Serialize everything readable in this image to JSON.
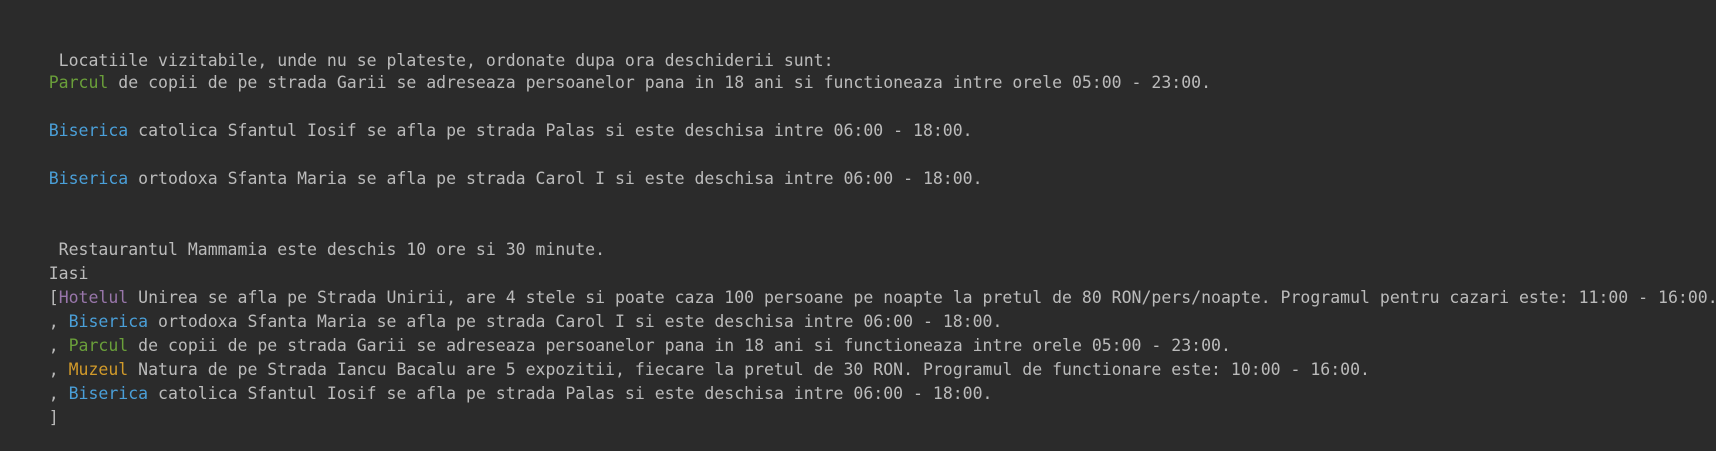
{
  "theme": {
    "background": "#2b2b2b",
    "text": "#bbbbbb",
    "green": "#6a9f3a",
    "blue": "#4a9fd8",
    "purple": "#9876aa",
    "gold": "#d19a2a"
  },
  "output": {
    "header1": " Locatiile vizitabile, unde nu se plateste, ordonate dupa ora deschiderii sunt:",
    "list1": [
      {
        "keyword": "Parcul",
        "color": "green",
        "text": " de copii de pe strada Garii se adreseaza persoanelor pana in 18 ani si functioneaza intre orele 05:00 - 23:00."
      },
      {
        "keyword": "Biserica",
        "color": "blue",
        "text": " catolica Sfantul Iosif se afla pe strada Palas si este deschisa intre 06:00 - 18:00."
      },
      {
        "keyword": "Biserica",
        "color": "blue",
        "text": " ortodoxa Sfanta Maria se afla pe strada Carol I si este deschisa intre 06:00 - 18:00."
      }
    ],
    "restaurant": " Restaurantul Mammamia este deschis 10 ore si 30 minute.",
    "city": "Iasi",
    "list2": [
      {
        "prefix": "[",
        "keyword": "Hotelul",
        "color": "purple",
        "text": " Unirea se afla pe Strada Unirii, are 4 stele si poate caza 100 persoane pe noapte la pretul de 80 RON/pers/noapte. Programul pentru cazari este: 11:00 - 16:00."
      },
      {
        "prefix": ", ",
        "keyword": "Biserica",
        "color": "blue",
        "text": " ortodoxa Sfanta Maria se afla pe strada Carol I si este deschisa intre 06:00 - 18:00."
      },
      {
        "prefix": ", ",
        "keyword": "Parcul",
        "color": "green",
        "text": " de copii de pe strada Garii se adreseaza persoanelor pana in 18 ani si functioneaza intre orele 05:00 - 23:00."
      },
      {
        "prefix": ", ",
        "keyword": "Muzeul",
        "color": "gold",
        "text": " Natura de pe Strada Iancu Bacalu are 5 expozitii, fiecare la pretul de 30 RON. Programul de functionare este: 10:00 - 16:00."
      },
      {
        "prefix": ", ",
        "keyword": "Biserica",
        "color": "blue",
        "text": " catolica Sfantul Iosif se afla pe strada Palas si este deschisa intre 06:00 - 18:00."
      }
    ],
    "closing": "]"
  }
}
